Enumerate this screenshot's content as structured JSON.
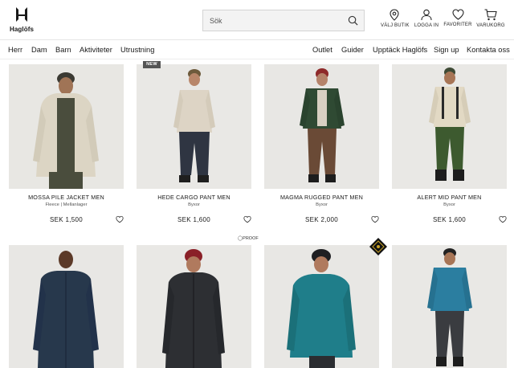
{
  "brand": {
    "name": "Haglöfs"
  },
  "search": {
    "placeholder": "Sök"
  },
  "header_icons": [
    {
      "label": "VÄLJ BUTIK",
      "icon": "location-pin-icon"
    },
    {
      "label": "LOGGA IN",
      "icon": "user-icon"
    },
    {
      "label": "FAVORITER",
      "icon": "heart-icon"
    },
    {
      "label": "VARUKORG",
      "icon": "cart-icon"
    }
  ],
  "nav_left": [
    "Herr",
    "Dam",
    "Barn",
    "Aktiviteter",
    "Utrustning"
  ],
  "nav_right": [
    "Outlet",
    "Guider",
    "Upptäck Haglöfs",
    "Sign up",
    "Kontakta oss"
  ],
  "badges": {
    "new": "NEW",
    "proof": "PROOF"
  },
  "products": [
    {
      "name": "MOSSA PILE JACKET MEN",
      "category": "Fleece | Mellanlager",
      "price": "SEK 1,500"
    },
    {
      "name": "HEDE CARGO PANT MEN",
      "category": "Byxor",
      "price": "SEK 1,600"
    },
    {
      "name": "MAGMA RUGGED PANT MEN",
      "category": "Byxor",
      "price": "SEK 2,000"
    },
    {
      "name": "ALERT MID PANT MEN",
      "category": "Byxor",
      "price": "SEK 1,600"
    }
  ],
  "colors": {
    "accent": "#1a1a1a",
    "image_bg": "#e9e9e7"
  }
}
